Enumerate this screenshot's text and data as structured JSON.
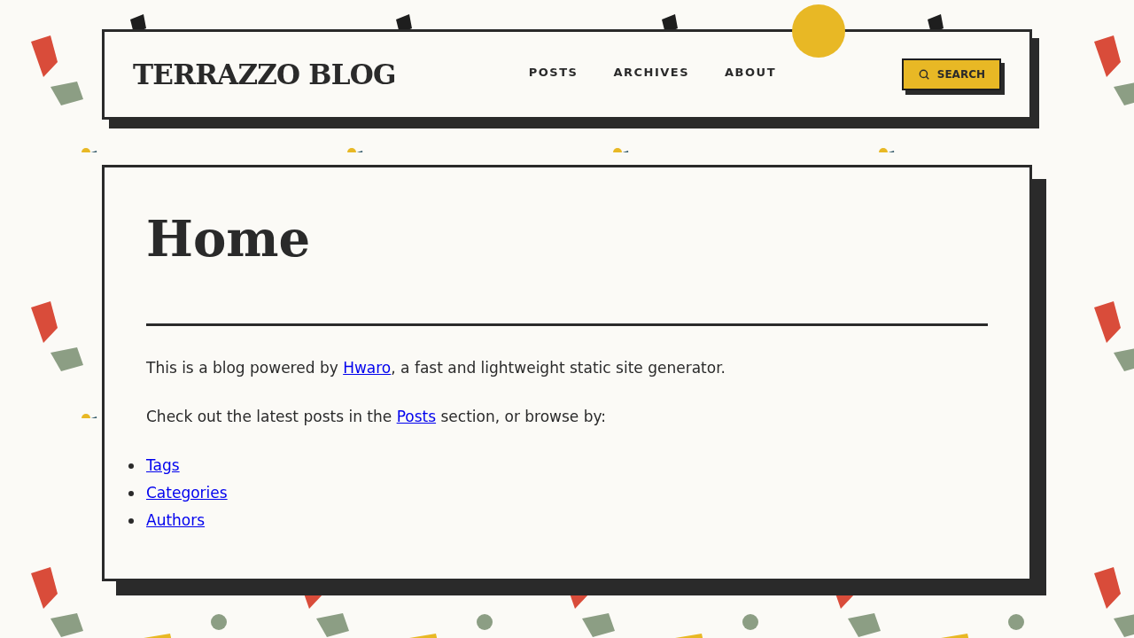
{
  "header": {
    "logo": "TERRAZZO BLOG",
    "nav": [
      {
        "label": "POSTS"
      },
      {
        "label": "ARCHIVES"
      },
      {
        "label": "ABOUT"
      }
    ],
    "search_button": "SEARCH"
  },
  "page": {
    "title": "Home",
    "paragraphs": [
      [
        {
          "kind": "text",
          "text": "This is a blog powered by "
        },
        {
          "kind": "link",
          "text": "Hwaro"
        },
        {
          "kind": "text",
          "text": ", a fast and lightweight static site generator."
        }
      ],
      [
        {
          "kind": "text",
          "text": "Check out the latest posts in the "
        },
        {
          "kind": "link",
          "text": "Posts"
        },
        {
          "kind": "text",
          "text": " section, or browse by:"
        }
      ]
    ],
    "links": [
      "Tags",
      "Categories",
      "Authors"
    ]
  }
}
